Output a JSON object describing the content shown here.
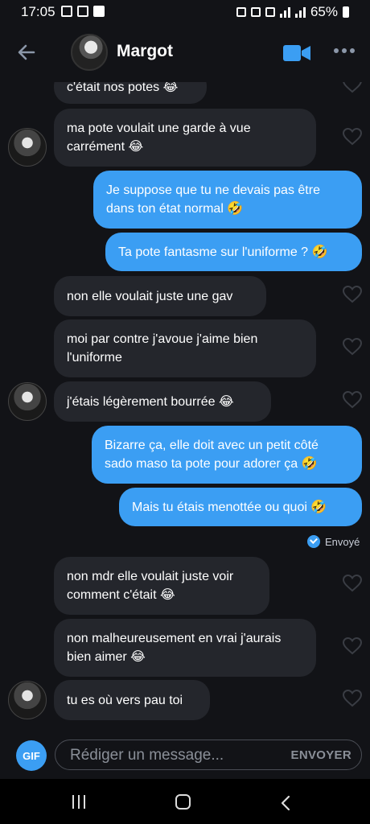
{
  "status": {
    "time": "17:05",
    "battery": "65%"
  },
  "header": {
    "contact_name": "Margot"
  },
  "messages": [
    {
      "dir": "in",
      "text": "c'était nos potes 😂"
    },
    {
      "dir": "in",
      "text": "ma pote voulait une garde à vue carrément 😂"
    },
    {
      "dir": "out",
      "text": "Je suppose que tu ne devais pas être dans ton état normal 🤣"
    },
    {
      "dir": "out",
      "text": "Ta pote fantasme sur l'uniforme ? 🤣"
    },
    {
      "dir": "in",
      "text": "non elle voulait juste une gav"
    },
    {
      "dir": "in",
      "text": "moi par contre j'avoue j'aime bien l'uniforme"
    },
    {
      "dir": "in",
      "text": "j'étais légèrement bourrée 😂"
    },
    {
      "dir": "out",
      "text": "Bizarre ça, elle doit avec un petit côté sado maso ta pote pour adorer ça 🤣"
    },
    {
      "dir": "out",
      "text": "Mais tu étais menottée ou quoi 🤣"
    },
    {
      "dir": "in",
      "text": "non mdr elle voulait juste voir comment c'était 😂"
    },
    {
      "dir": "in",
      "text": "non malheureusement en vrai j'aurais bien aimer 😂"
    },
    {
      "dir": "in",
      "text": "tu es où vers pau toi"
    }
  ],
  "sent_status": "Envoyé",
  "composer": {
    "gif_label": "GIF",
    "placeholder": "Rédiger un message...",
    "send_label": "ENVOYER"
  },
  "colors": {
    "outgoing": "#3b9ef3",
    "incoming": "#24262c",
    "background": "#121317"
  }
}
